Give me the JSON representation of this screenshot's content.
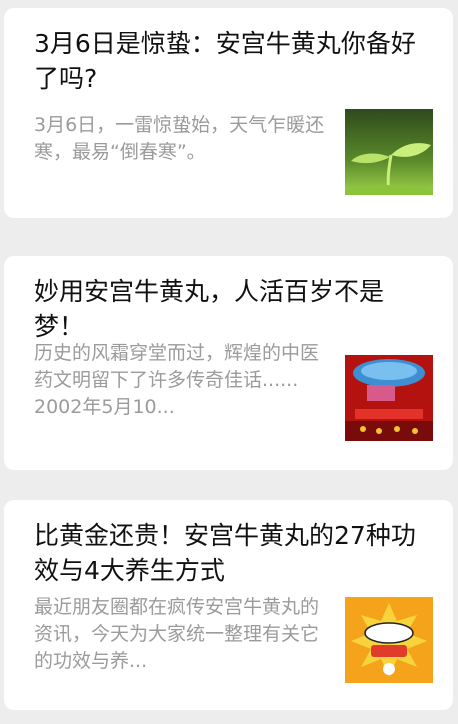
{
  "articles": [
    {
      "title": "3月6日是惊蛰：安宫牛黄丸你备好了吗?",
      "summary": "3月6日，一雷惊蛰始，天气乍暖还寒，最易“倒春寒”。",
      "thumbnail": "sprout-image"
    },
    {
      "title": "妙用安宫牛黄丸，人活百岁不是梦！",
      "summary": "历史的风霜穿堂而过，辉煌的中医药文明留下了许多传奇佳话...... 2002年5月10...",
      "thumbnail": "red-stage-image"
    },
    {
      "title": "比黄金还贵！安宫牛黄丸的27种功效与4大养生方式",
      "summary": "最近朋友圈都在疯传安宫牛黄丸的资讯，今天为大家统一整理有关它的功效与养...",
      "thumbnail": "wow-comic-image"
    }
  ],
  "colors": {
    "background": "#ededed",
    "card": "#ffffff",
    "title": "#111111",
    "summary": "#9b9b9b"
  }
}
